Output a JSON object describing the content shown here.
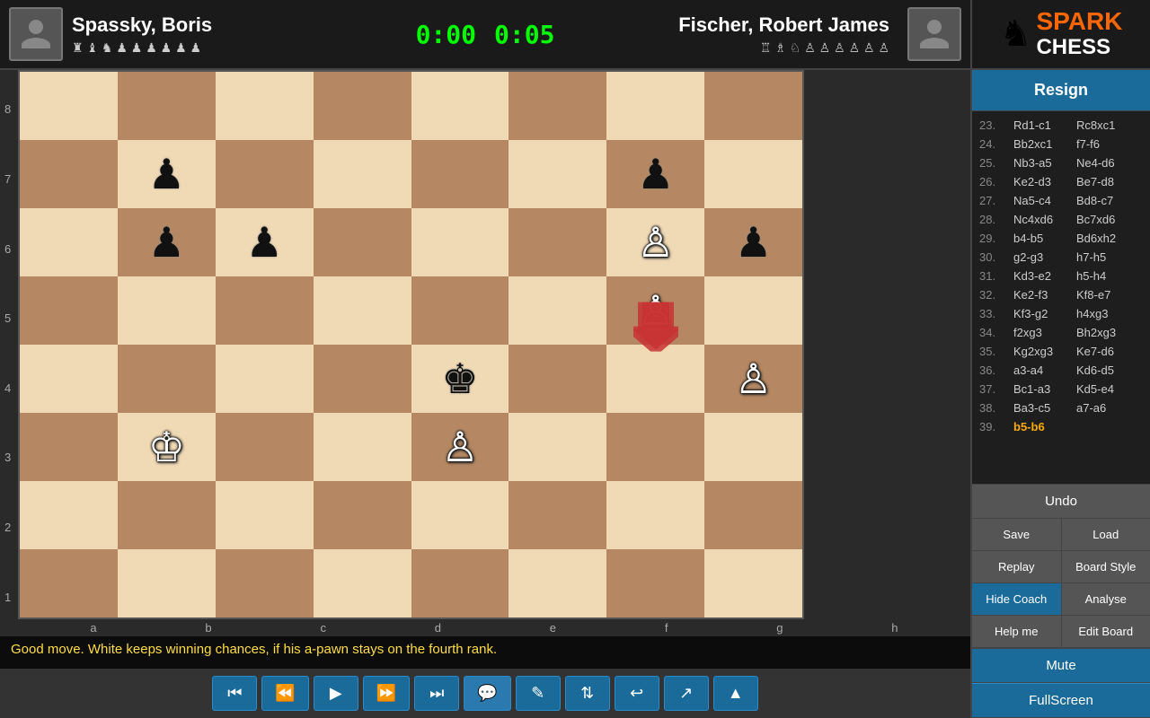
{
  "header": {
    "player_left": {
      "name": "Spassky, Boris",
      "pieces": "♜♝♞♟♟♟♟♟♟"
    },
    "player_right": {
      "name": "Fischer, Robert James",
      "pieces": "♖♗♘♙♙♙♙♙♙"
    },
    "timer_left": "0:00",
    "timer_right": "0:05",
    "logo_line1": "SPARK",
    "logo_line2": "CHESS"
  },
  "board": {
    "rank_labels": [
      "1",
      "2",
      "3",
      "4",
      "5",
      "6",
      "7",
      "8"
    ],
    "file_labels": [
      "a",
      "b",
      "c",
      "d",
      "e",
      "f",
      "g",
      "h"
    ]
  },
  "moves": [
    {
      "num": "23.",
      "white": "Rd1-c1",
      "black": "Rc8xc1"
    },
    {
      "num": "24.",
      "white": "Bb2xc1",
      "black": "f7-f6"
    },
    {
      "num": "25.",
      "white": "Nb3-a5",
      "black": "Ne4-d6"
    },
    {
      "num": "26.",
      "white": "Ke2-d3",
      "black": "Be7-d8"
    },
    {
      "num": "27.",
      "white": "Na5-c4",
      "black": "Bd8-c7"
    },
    {
      "num": "28.",
      "white": "Nc4xd6",
      "black": "Bc7xd6"
    },
    {
      "num": "29.",
      "white": "b4-b5",
      "black": "Bd6xh2"
    },
    {
      "num": "30.",
      "white": "g2-g3",
      "black": "h7-h5"
    },
    {
      "num": "31.",
      "white": "Kd3-e2",
      "black": "h5-h4"
    },
    {
      "num": "32.",
      "white": "Ke2-f3",
      "black": "Kf8-e7"
    },
    {
      "num": "33.",
      "white": "Kf3-g2",
      "black": "h4xg3"
    },
    {
      "num": "34.",
      "white": "f2xg3",
      "black": "Bh2xg3"
    },
    {
      "num": "35.",
      "white": "Kg2xg3",
      "black": "Ke7-d6"
    },
    {
      "num": "36.",
      "white": "a3-a4",
      "black": "Kd6-d5"
    },
    {
      "num": "37.",
      "white": "Bc1-a3",
      "black": "Kd5-e4"
    },
    {
      "num": "38.",
      "white": "Ba3-c5",
      "black": "a7-a6"
    },
    {
      "num": "39.",
      "white": "b5-b6",
      "black": ""
    }
  ],
  "buttons": {
    "resign": "Resign",
    "undo": "Undo",
    "save": "Save",
    "load": "Load",
    "replay": "Replay",
    "board_style": "Board Style",
    "hide_coach": "Hide Coach",
    "analyse": "Analyse",
    "help_me": "Help me",
    "edit_board": "Edit Board",
    "mute": "Mute",
    "fullscreen": "FullScreen"
  },
  "coach_message": "Good move. White keeps winning chances, if his a-pawn stays on the fourth rank.",
  "controls": {
    "first": "⏮",
    "prev": "⏭",
    "play": "▶",
    "next": "⏩",
    "last": "⏭",
    "chat": "💬",
    "edit": "✎",
    "flip": "⇅",
    "signin": "→",
    "share": "↗",
    "menu": "▲"
  }
}
